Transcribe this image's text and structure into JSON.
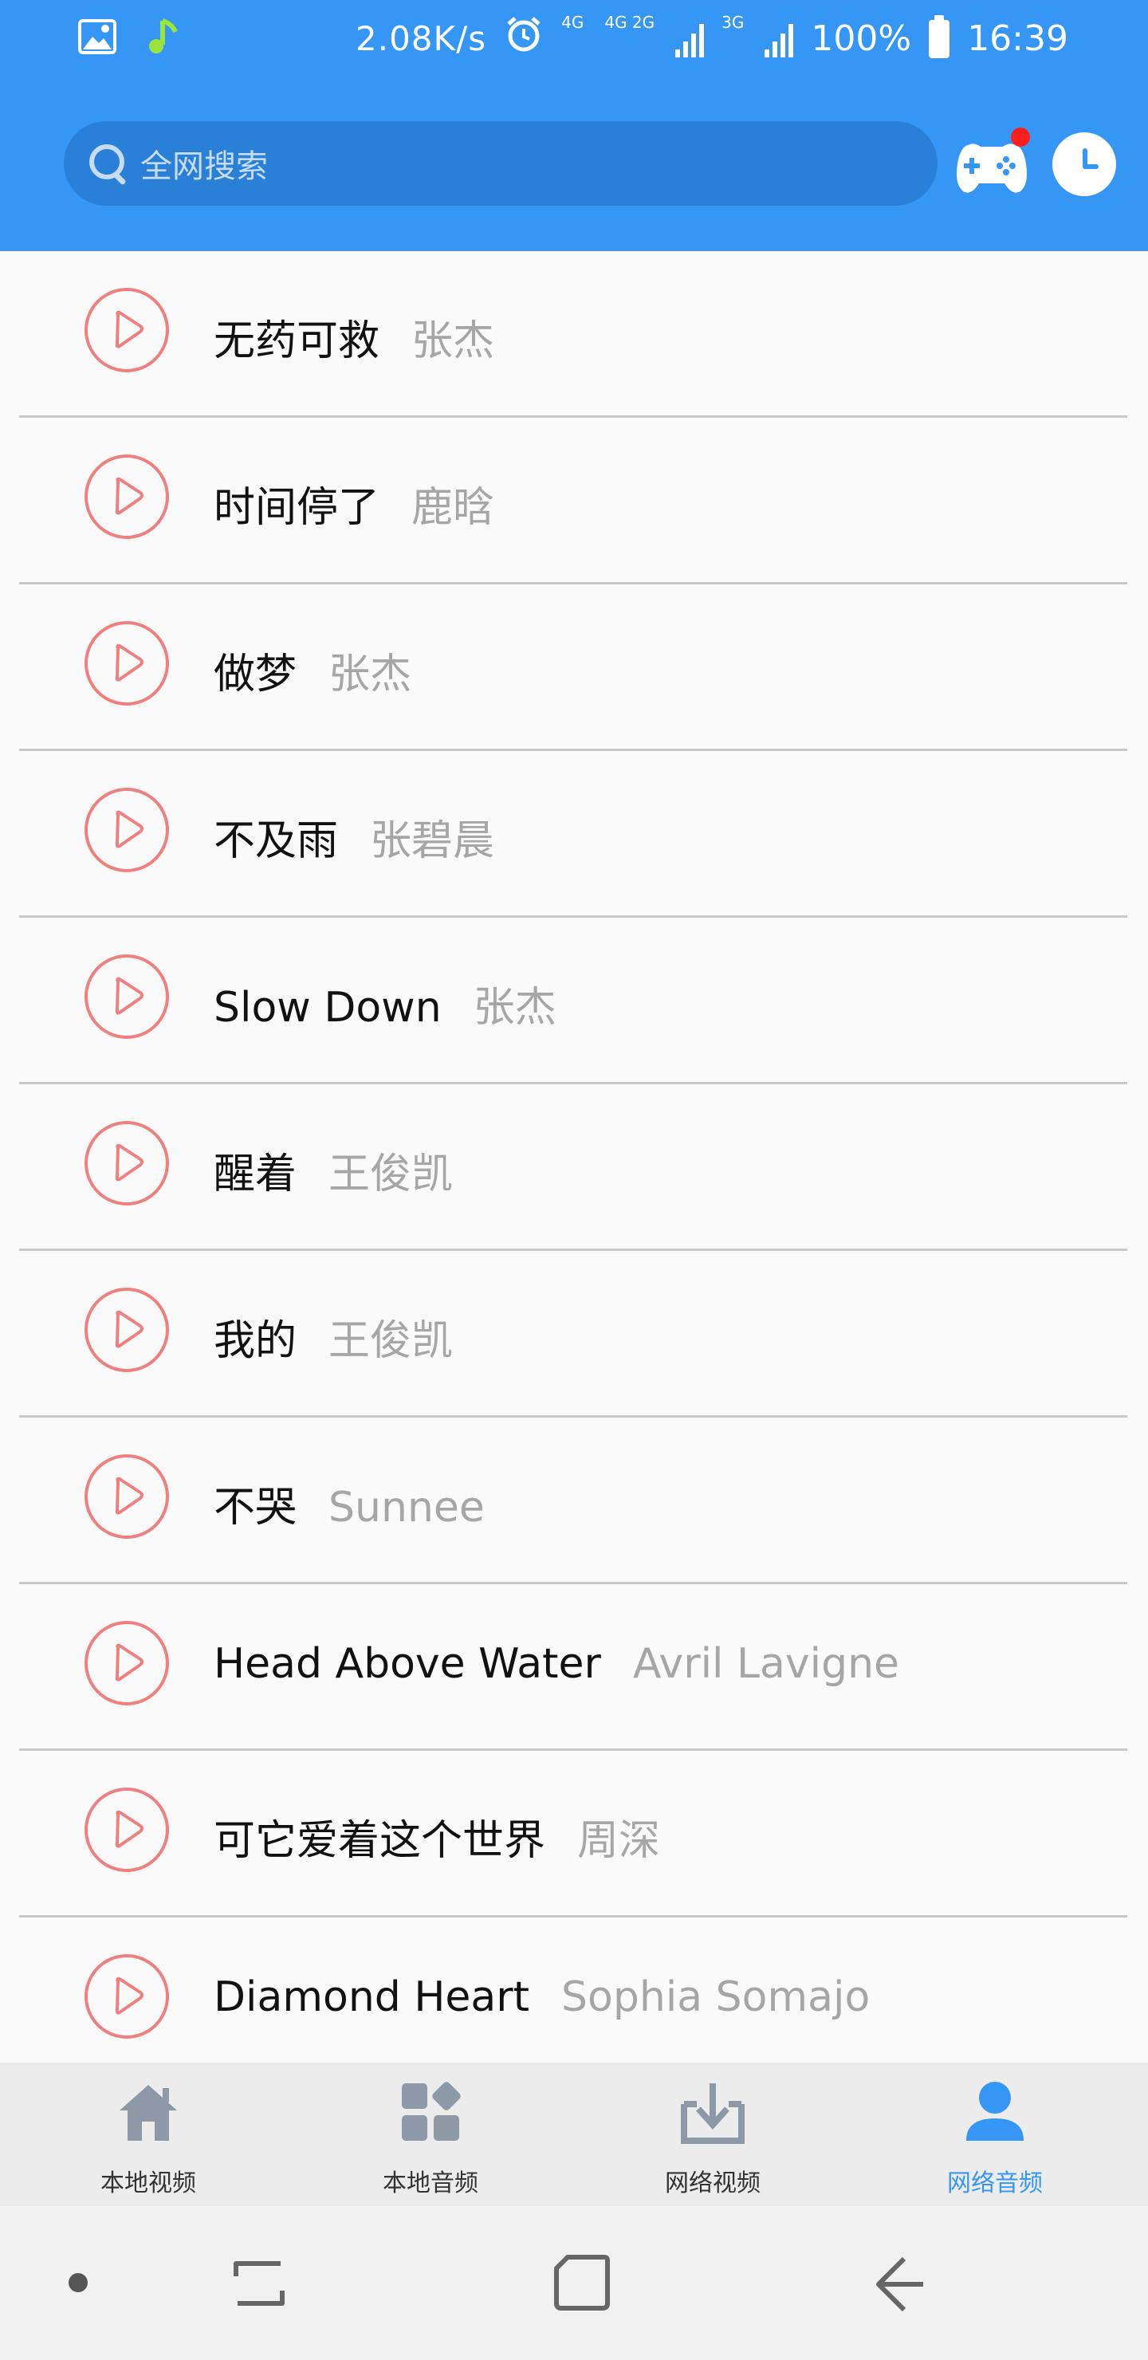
{
  "status_bar": {
    "net_speed": "2.08K/s",
    "net_4g": "4G",
    "net_4g2g": "4G 2G",
    "net_3g": "3G",
    "battery": "100%",
    "time": "16:39"
  },
  "search": {
    "placeholder": "全网搜索"
  },
  "songs": [
    {
      "title": "无药可救",
      "artist": "张杰"
    },
    {
      "title": "时间停了",
      "artist": "鹿晗"
    },
    {
      "title": "做梦",
      "artist": "张杰"
    },
    {
      "title": "不及雨",
      "artist": "张碧晨"
    },
    {
      "title": "Slow Down",
      "artist": "张杰"
    },
    {
      "title": "醒着",
      "artist": "王俊凯"
    },
    {
      "title": "我的",
      "artist": "王俊凯"
    },
    {
      "title": "不哭",
      "artist": "Sunnee"
    },
    {
      "title": "Head Above Water",
      "artist": "Avril Lavigne"
    },
    {
      "title": "可它爱着这个世界",
      "artist": "周深"
    },
    {
      "title": "Diamond Heart",
      "artist": "Sophia Somajo"
    }
  ],
  "tabs": [
    {
      "label": "本地视频",
      "icon": "home-icon"
    },
    {
      "label": "本地音频",
      "icon": "apps-icon"
    },
    {
      "label": "网络视频",
      "icon": "download-icon"
    },
    {
      "label": "网络音频",
      "icon": "person-icon",
      "active": true
    }
  ],
  "colors": {
    "primary": "#3596f6",
    "play_ring": "#f08080",
    "artist_text": "#a6a6a6"
  }
}
